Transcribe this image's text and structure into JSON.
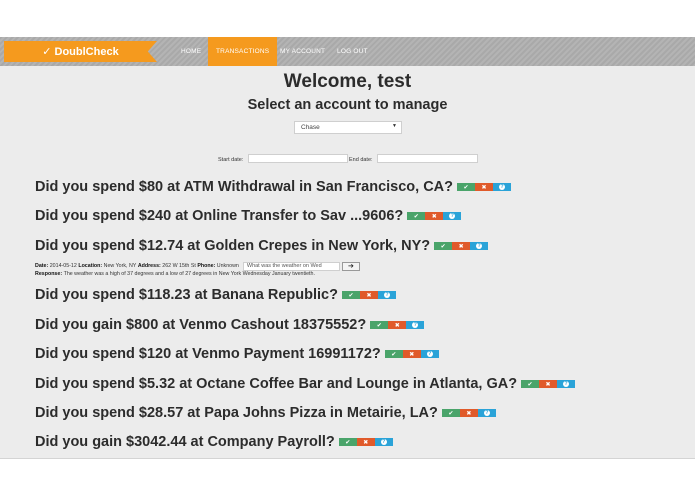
{
  "header": {
    "logo_text": "DoublCheck",
    "nav": [
      "HOME",
      "TRANSACTIONS",
      "MY ACCOUNT",
      "LOG OUT"
    ],
    "active_nav": "TRANSACTIONS",
    "accent_color": "#f59a1e"
  },
  "main": {
    "welcome": "Welcome, test",
    "subtitle": "Select an account to manage",
    "account_select": "Chase",
    "start_date_label": "Start date:",
    "end_date_label": "End date:"
  },
  "transactions": [
    "Did you spend $80 at ATM Withdrawal in San Francisco, CA?",
    "Did you spend $240 at Online Transfer to Sav ...9606?",
    "Did you spend $12.74 at Golden Crepes in New York, NY?",
    "Did you spend $118.23 at Banana Republic?",
    "Did you gain $800 at Venmo Cashout 18375552?",
    "Did you spend $120 at Venmo Payment 16991172?",
    "Did you spend $5.32 at Octane Coffee Bar and Lounge in Atlanta, GA?",
    "Did you spend $28.57 at Papa Johns Pizza in Metairie, LA?",
    "Did you gain $3042.44 at Company Payroll?"
  ],
  "details": {
    "date_label": "Date:",
    "date": "2014-05-12",
    "location_label": "Location:",
    "location": "New York, NY",
    "address_label": "Address:",
    "address": "262 W 15th St",
    "phone_label": "Phone:",
    "phone": "Unknown",
    "question_value": "What was the weather on Wed",
    "response_label": "Response:",
    "response": "The weather was a high of 37 degrees and a low of 27 degrees in New York Wednesday January twentieth."
  },
  "icons": {
    "confirm": "check-icon",
    "reject": "close-icon",
    "help": "help-icon",
    "submit": "arrow-right-icon"
  }
}
